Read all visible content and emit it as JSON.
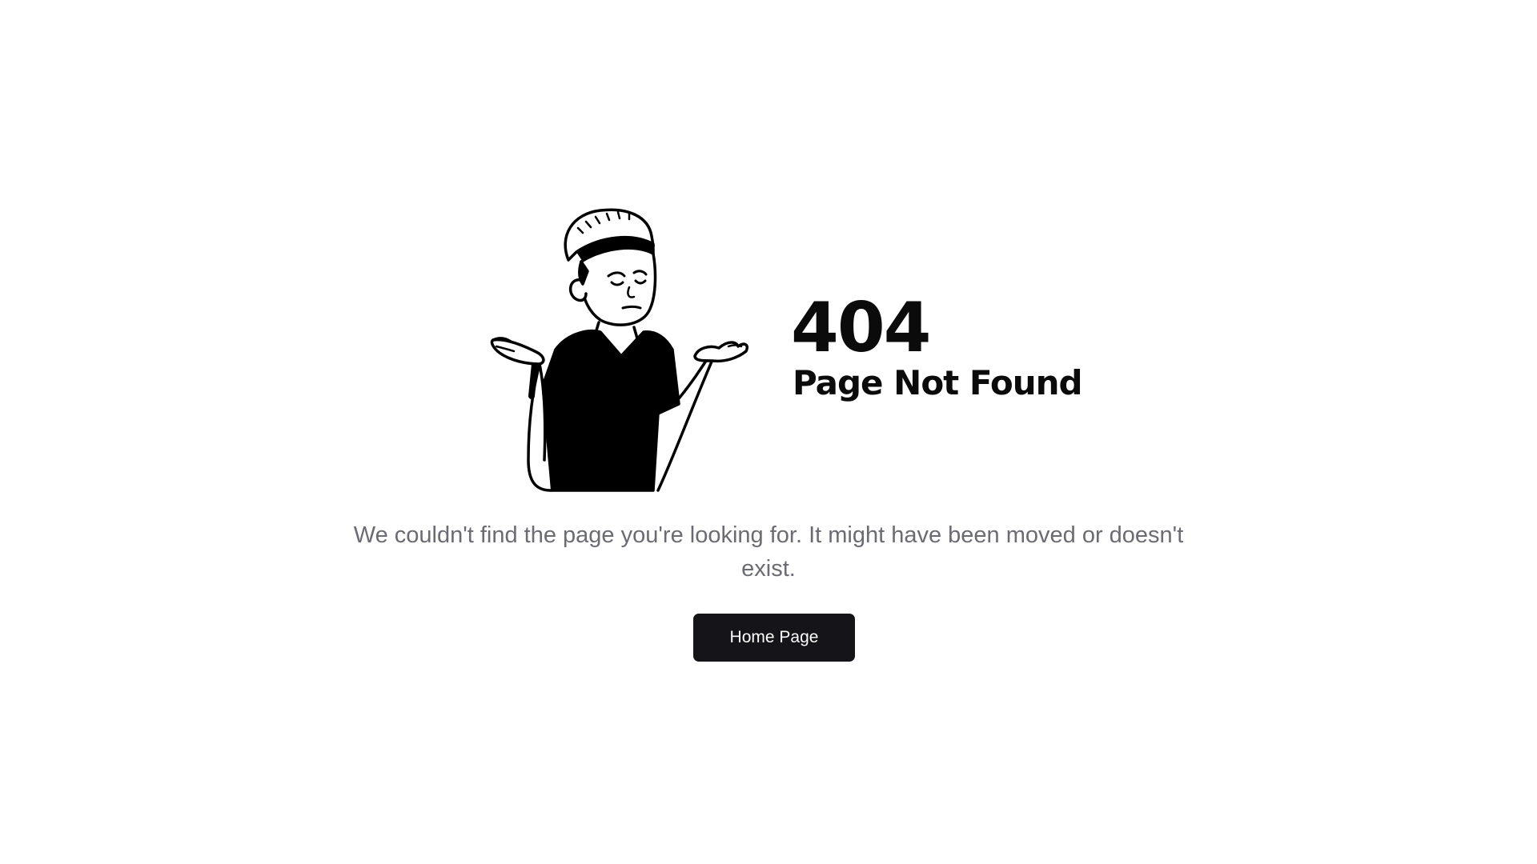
{
  "error": {
    "code": "404",
    "title": "Page Not Found",
    "message": "We couldn't find the page you're looking for. It might have been moved or doesn't exist."
  },
  "actions": {
    "home_button_label": "Home Page"
  },
  "illustration": {
    "icon": "shrugging-person-illustration"
  },
  "colors": {
    "background": "#ffffff",
    "heading": "#0b0b0b",
    "body_text": "#6b6b73",
    "button_bg": "#141419",
    "button_text": "#ffffff"
  }
}
